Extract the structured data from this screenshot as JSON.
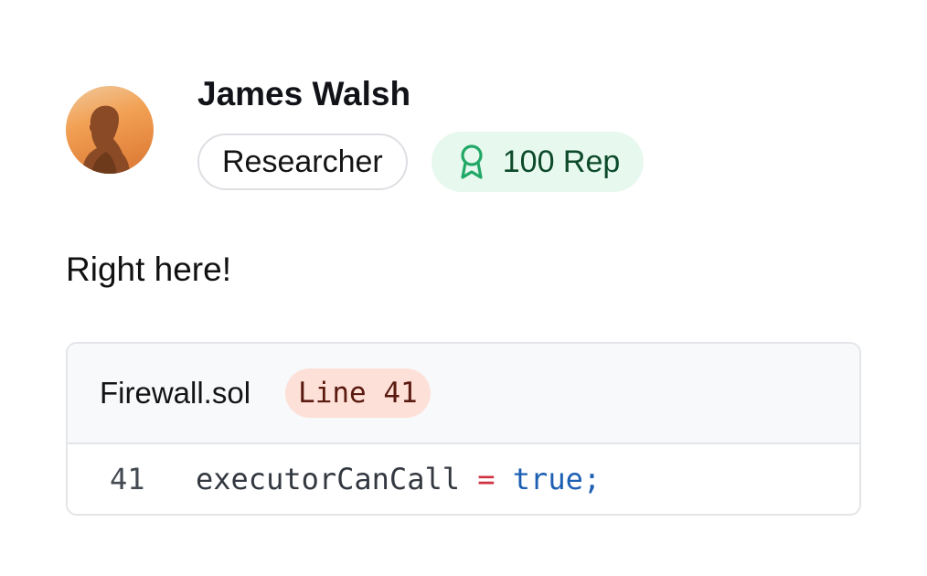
{
  "author": {
    "name": "James Walsh",
    "role": "Researcher",
    "reputation": "100 Rep",
    "avatar_icon": "person-silhouette-sunset"
  },
  "comment": {
    "text": "Right here!"
  },
  "code_reference": {
    "file_name": "Firewall.sol",
    "line_tag": "Line 41",
    "line_number": "41",
    "tokens": {
      "identifier": "executorCanCall",
      "operator": "=",
      "value": "true",
      "terminator": ";"
    }
  },
  "colors": {
    "rep_badge_bg": "#e7f8ef",
    "rep_icon": "#22a866",
    "line_tag_bg": "#fde1d8",
    "operator": "#d0313e",
    "keyword": "#1d5fb3"
  }
}
